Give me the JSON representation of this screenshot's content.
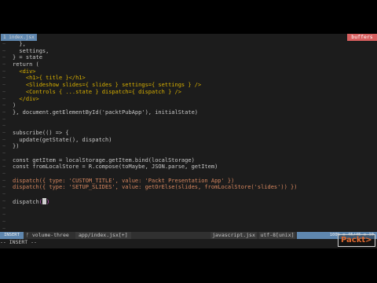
{
  "tabline": {
    "active_tab": "1  index.jsx",
    "buffers_label": "buffers"
  },
  "code_lines": [
    "  },",
    "  settings,",
    "} = state",
    "return (",
    "  <div>",
    "    <h1>{ title }</h1>",
    "    <Slideshow slides={ slides } settings={ settings } />",
    "    <Controls { ...state } dispatch={ dispatch } />",
    "  </div>",
    ")",
    "}, document.getElementById('packtPubApp'), initialState)",
    "",
    "",
    "subscribe(() => {",
    "  update(getState(), dispatch)",
    "})",
    "",
    "const getItem = localStorage.getItem.bind(localStorage)",
    "const fromLocalStore = R.compose(toMaybe, JSON.parse, getItem)",
    "",
    "dispatch({ type: 'CUSTOM_TITLE', value: 'Packt Presentation App' })",
    "dispatch({ type: 'SETUP_SLIDES', value: getOrElse(slides, fromLocalStore('slides')) })",
    "",
    "dispatch",
    "(",
    ")"
  ],
  "statusbar": {
    "mode": "INSERT",
    "branch": "ᚠ volume-three",
    "file": "app/index.jsx[+]",
    "filetype": "javascript.jsx",
    "encoding": "utf-8[unix]",
    "position": "100% ≡ 45/45 ≡ 10"
  },
  "cmdline": "-- INSERT --",
  "watermark": "Packt>"
}
